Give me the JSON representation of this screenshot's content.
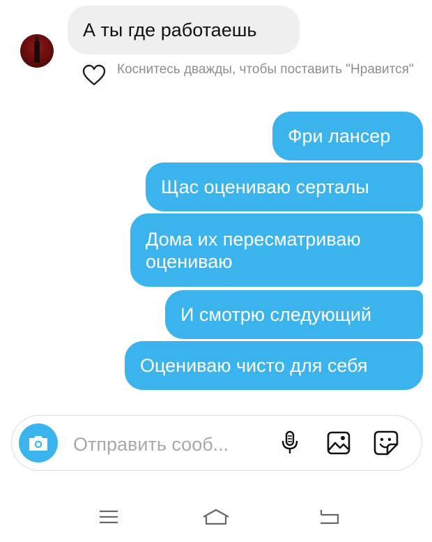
{
  "incoming": {
    "text": "А ты где работаешь",
    "like_hint": "Коснитесь дважды, чтобы поставить \"Нравится\""
  },
  "outgoing": [
    "Фри лансер",
    "Щас оцениваю серталы",
    "Дома их пересматриваю\nоцениваю",
    "И смотрю следующий",
    "Оцениваю чисто для себя"
  ],
  "composer": {
    "placeholder": "Отправить сооб..."
  },
  "icons": {
    "avatar": "avatar",
    "like": "heart-icon",
    "camera": "camera-icon",
    "mic": "microphone-icon",
    "gallery": "gallery-icon",
    "sticker": "sticker-icon",
    "nav_menu": "menu-icon",
    "nav_home": "home-icon",
    "nav_back": "back-icon"
  },
  "colors": {
    "outgoing_bubble": "#3bb4ee",
    "incoming_bubble": "#efefef",
    "hint_text": "#8e8e8e"
  }
}
